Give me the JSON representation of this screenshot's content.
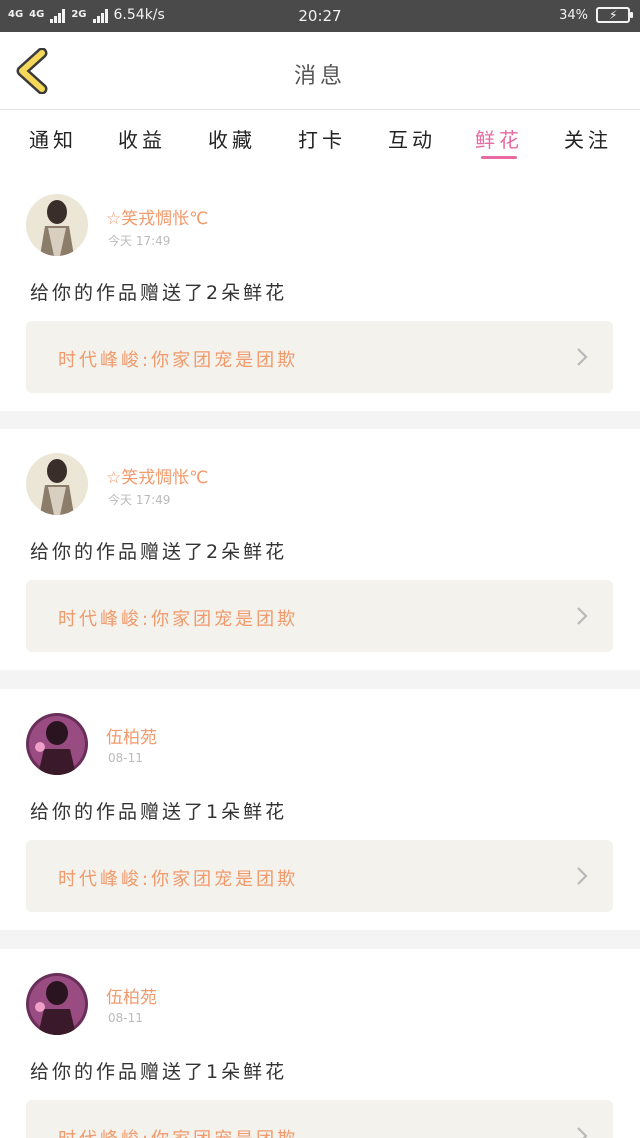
{
  "status": {
    "net1": "4G",
    "net2": "4G",
    "net3": "2G",
    "speed": "6.54k/s",
    "time": "20:27",
    "battery": "34%",
    "battery_level": 0.34
  },
  "header": {
    "title": "消息",
    "back_icon": "chevron-left-icon"
  },
  "tabs": [
    {
      "label": "通知",
      "active": false
    },
    {
      "label": "收益",
      "active": false
    },
    {
      "label": "收藏",
      "active": false
    },
    {
      "label": "打卡",
      "active": false
    },
    {
      "label": "互动",
      "active": false
    },
    {
      "label": "鲜花",
      "active": true
    },
    {
      "label": "关注",
      "active": false
    }
  ],
  "colors": {
    "accent_pink": "#e86aa0",
    "orange_text": "#f19a6c",
    "chevron_yellow": "#f5d85a"
  },
  "messages": [
    {
      "user": "☆笑戎惆怅℃",
      "time": "今天 17:49",
      "text": "给你的作品赠送了2朵鲜花",
      "work": "时代峰峻:你家团宠是团欺"
    },
    {
      "user": "☆笑戎惆怅℃",
      "time": "今天 17:49",
      "text": "给你的作品赠送了2朵鲜花",
      "work": "时代峰峻:你家团宠是团欺"
    },
    {
      "user": "伍柏苑",
      "time": "08-11",
      "text": "给你的作品赠送了1朵鲜花",
      "work": "时代峰峻:你家团宠是团欺"
    },
    {
      "user": "伍柏苑",
      "time": "08-11",
      "text": "给你的作品赠送了1朵鲜花",
      "work": "时代峰峻:你家团宠是团欺"
    }
  ]
}
